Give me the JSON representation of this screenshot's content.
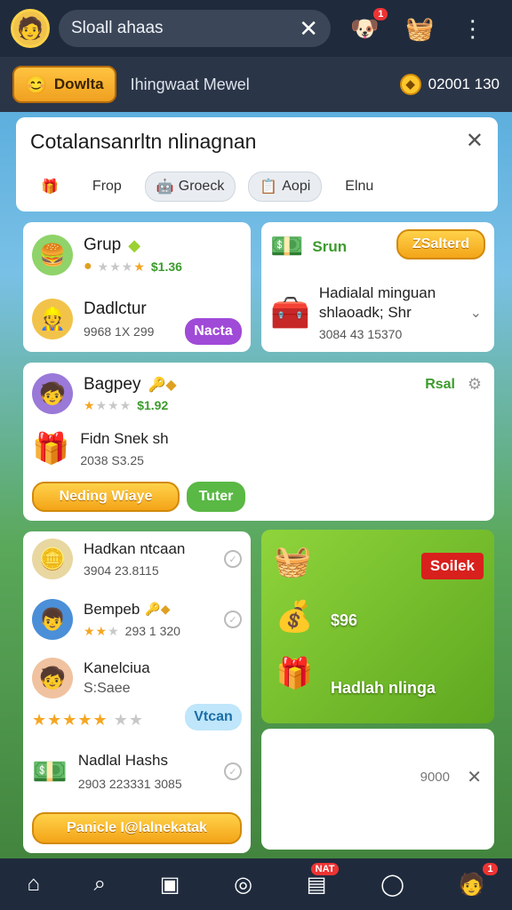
{
  "topbar": {
    "search_text": "Sloall ahaas",
    "close_glyph": "✕",
    "notif_badge": "1"
  },
  "subbar": {
    "coin_button_label": "Dowlta",
    "title": "Ihingwaat Mewel",
    "balance": "02001 130"
  },
  "dialog": {
    "title": "Cotalansanrltn nlinagnan",
    "close_glyph": "✕",
    "tabs": [
      {
        "label": "Frop",
        "icon": "tag-icon"
      },
      {
        "label": "Groeck",
        "icon": "robot-icon"
      },
      {
        "label": "Aopi",
        "icon": "clipboard-icon"
      },
      {
        "label": "Elnu",
        "icon": ""
      }
    ]
  },
  "card1": {
    "item1_name": "Grup",
    "item1_price": "$1.36",
    "item2_name": "Dadlctur",
    "item2_meta": "9968 1X 299",
    "button": "Nacta"
  },
  "card2": {
    "label": "Srun",
    "button": "ZSalterd",
    "item_name": "Hadialal minguan",
    "item_sub": "shlaoadk; Shr",
    "item_meta": "3084 43 15370"
  },
  "card3": {
    "name": "Bagpey",
    "price": "$1.92",
    "link": "Rsal",
    "sub_name": "Fidn Snek sh",
    "sub_meta": "2038 S3.25",
    "button_primary": "Neding Wiaye",
    "button_secondary": "Tuter"
  },
  "list": {
    "items": [
      {
        "name": "Hadkan ntcaan",
        "meta": "3904 23.8115"
      },
      {
        "name": "Bempeb",
        "meta": "293 1 320"
      },
      {
        "name": "Kanelciua",
        "meta": "S:Saee"
      },
      {
        "name": "Nadlal Hashs",
        "meta": "2903 223331 3085"
      }
    ],
    "item3_button": "Vtcan",
    "footer_button": "Panicle I@lalnekatak"
  },
  "promo": {
    "sale_label": "Soilek",
    "amount": "$96",
    "caption": "Hadlah nlinga"
  },
  "empty_card": {
    "value": "9000"
  },
  "navbar": {
    "badge_label": "NAT",
    "profile_badge": "1"
  }
}
